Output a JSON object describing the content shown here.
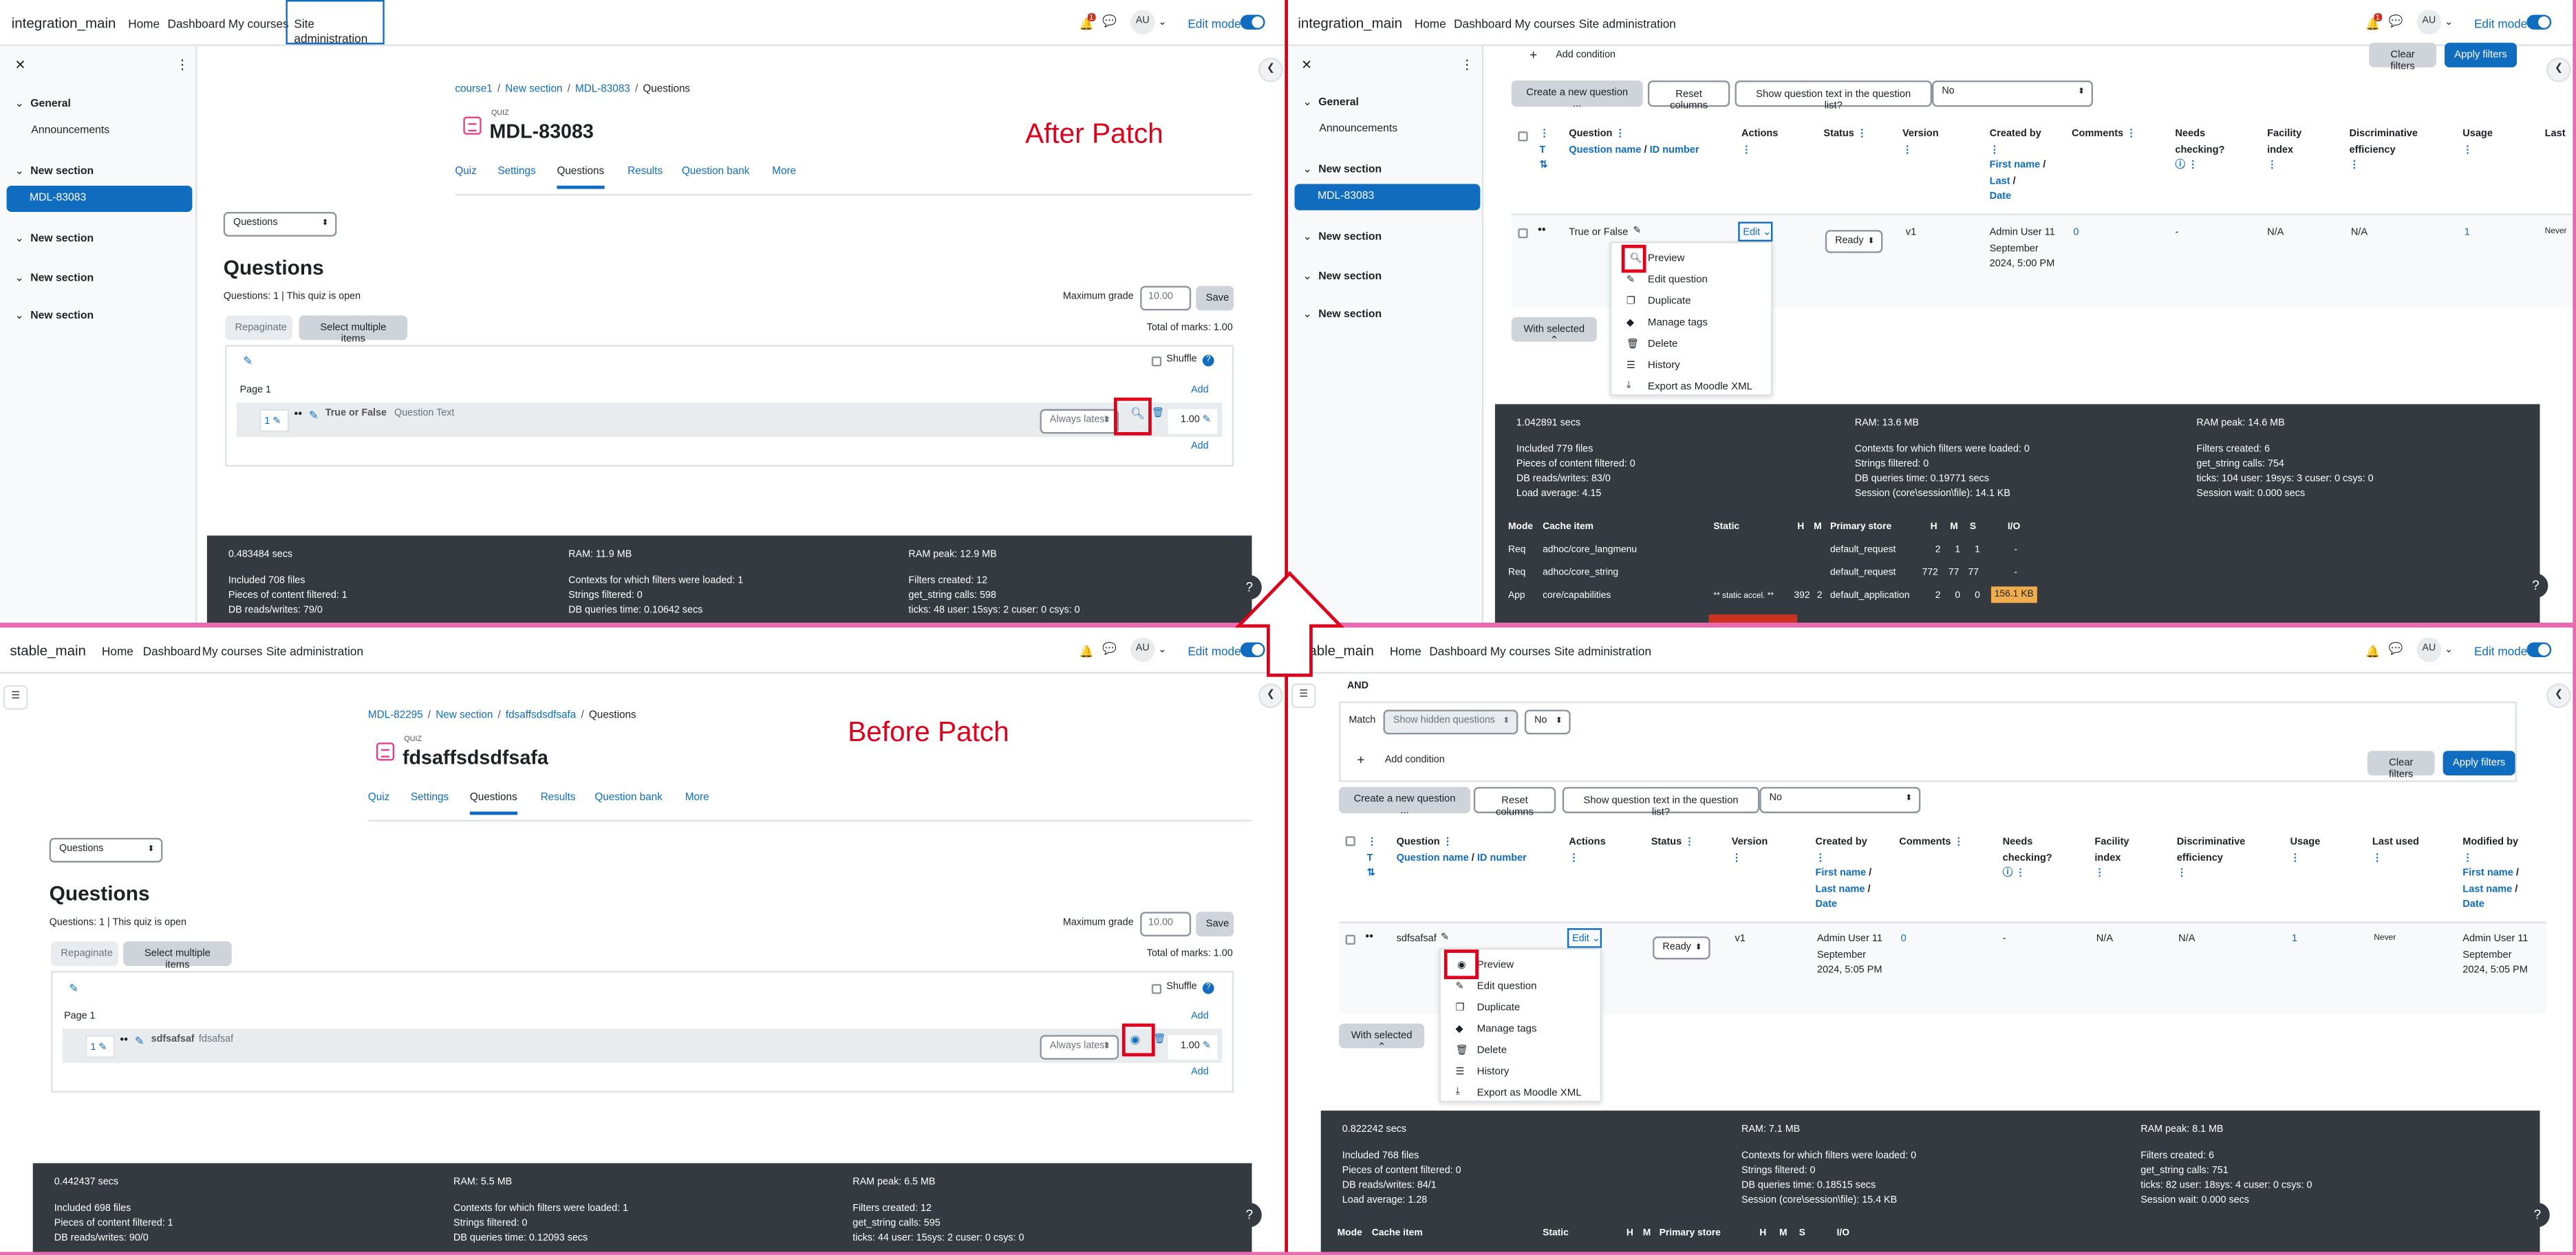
{
  "q1": {
    "brand": "integration_main",
    "nav": [
      "Home",
      "Dashboard",
      "My courses",
      "Site administration"
    ],
    "notif_count": "1",
    "avatar": "AU",
    "edit_mode": "Edit mode",
    "drawer": {
      "general": "General",
      "announcements": "Announcements",
      "new_section": "New section",
      "active": "MDL-83083"
    },
    "breadcrumb": [
      "course1",
      "New section",
      "MDL-83083",
      "Questions"
    ],
    "quiz_label": "QUIZ",
    "title": "MDL-83083",
    "tabs": [
      "Quiz",
      "Settings",
      "Questions",
      "Results",
      "Question bank",
      "More"
    ],
    "select_value": "Questions",
    "heading": "Questions",
    "status_line": "Questions: 1 | This quiz is open",
    "max_grade_label": "Maximum grade",
    "max_grade_value": "10.00",
    "save": "Save",
    "repaginate": "Repaginate",
    "select_multiple": "Select multiple items",
    "total_marks": "Total of marks: 1.00",
    "shuffle": "Shuffle",
    "page": "Page 1",
    "add": "Add",
    "slot_num": "1",
    "q_name": "True or False",
    "q_text": "Question Text",
    "version": "Always latest",
    "mark": "1.00",
    "annotation": "After Patch",
    "perf": {
      "secs": "0.483484 secs",
      "ram": "RAM: 11.9 MB",
      "ram_peak": "RAM peak: 12.9 MB",
      "files": "Included 708 files",
      "filtered": "Pieces of content filtered: 1",
      "dbrw": "DB reads/writes: 79/0",
      "contexts": "Contexts for which filters were loaded: 1",
      "strings": "Strings filtered: 0",
      "dbq": "DB queries time: 0.10642 secs",
      "fcreated": "Filters created: 12",
      "getstr": "get_string calls: 598",
      "ticks": "ticks: 48 user: 15sys: 2 cuser: 0 csys: 0"
    }
  },
  "q2": {
    "brand": "integration_main",
    "nav": [
      "Home",
      "Dashboard",
      "My courses",
      "Site administration"
    ],
    "notif_count": "1",
    "avatar": "AU",
    "edit_mode": "Edit mode",
    "drawer": {
      "general": "General",
      "announcements": "Announcements",
      "new_section": "New section",
      "active": "MDL-83083"
    },
    "add_condition": "Add condition",
    "clear_filters": "Clear filters",
    "apply_filters": "Apply filters",
    "create_new": "Create a new question ...",
    "reset_columns": "Reset columns",
    "show_text_label": "Show question text in the question list?",
    "show_text_value": "No",
    "cols": {
      "t": "T",
      "question": "Question",
      "qname": "Question name",
      "idnum": "ID number",
      "actions": "Actions",
      "status": "Status",
      "version": "Version",
      "created_by": "Created by",
      "first": "First name",
      "last": "Last",
      "date": "Date",
      "comments": "Comments",
      "needs": "Needs checking?",
      "facility": "Facility index",
      "discrim": "Discriminative efficiency",
      "usage": "Usage"
    },
    "row": {
      "name": "True or False",
      "edit": "Edit",
      "status": "Ready",
      "version": "v1",
      "created": "Admin User 11 September 2024, 5:00 PM",
      "comments": "0",
      "needs": "-",
      "facility": "N/A",
      "discrim": "N/A",
      "usage": "1",
      "last": "Never"
    },
    "menu": [
      "Preview",
      "Edit question",
      "Duplicate",
      "Manage tags",
      "Delete",
      "History",
      "Export as Moodle XML"
    ],
    "with_selected": "With selected",
    "perf": {
      "secs": "1.042891 secs",
      "ram": "RAM: 13.6 MB",
      "ram_peak": "RAM peak: 14.6 MB",
      "files": "Included 779 files",
      "filtered": "Pieces of content filtered: 0",
      "dbrw": "DB reads/writes: 83/0",
      "load": "Load average: 4.15",
      "contexts": "Contexts for which filters were loaded: 0",
      "strings": "Strings filtered: 0",
      "dbq": "DB queries time: 0.19771 secs",
      "session": "Session (core\\session\\file): 14.1 KB",
      "fcreated": "Filters created: 6",
      "getstr": "get_string calls: 754",
      "ticks": "ticks: 104 user: 19sys: 3 cuser: 0 csys: 0",
      "wait": "Session wait: 0.000 secs"
    },
    "cache_head": [
      "Mode",
      "Cache item",
      "Static",
      "H",
      "M",
      "Primary store",
      "H",
      "M",
      "S",
      "I/O"
    ],
    "cache_rows": [
      [
        "Req",
        "adhoc/core_langmenu",
        "",
        "",
        "",
        "default_request",
        "2",
        "1",
        "1",
        "-"
      ],
      [
        "Req",
        "adhoc/core_string",
        "",
        "",
        "",
        "default_request",
        "772",
        "77",
        "77",
        "-"
      ],
      [
        "App",
        "core/capabilities",
        "** static accel. **",
        "392",
        "2",
        "default_application",
        "2",
        "0",
        "0",
        "156.1 KB"
      ]
    ]
  },
  "q3": {
    "brand": "stable_main",
    "nav": [
      "Home",
      "Dashboard",
      "My courses",
      "Site administration"
    ],
    "avatar": "AU",
    "edit_mode": "Edit mode",
    "breadcrumb": [
      "MDL-82295",
      "New section",
      "fdsaffsdsdfsafa",
      "Questions"
    ],
    "quiz_label": "QUIZ",
    "title": "fdsaffsdsdfsafa",
    "tabs": [
      "Quiz",
      "Settings",
      "Questions",
      "Results",
      "Question bank",
      "More"
    ],
    "select_value": "Questions",
    "heading": "Questions",
    "status_line": "Questions: 1 | This quiz is open",
    "max_grade_label": "Maximum grade",
    "max_grade_value": "10.00",
    "save": "Save",
    "repaginate": "Repaginate",
    "select_multiple": "Select multiple items",
    "total_marks": "Total of marks: 1.00",
    "shuffle": "Shuffle",
    "page": "Page 1",
    "add": "Add",
    "slot_num": "1",
    "q_name": "sdfsafsaf",
    "q_text": "fdsafsaf",
    "version": "Always latest",
    "mark": "1.00",
    "annotation": "Before Patch",
    "perf": {
      "secs": "0.442437 secs",
      "ram": "RAM: 5.5 MB",
      "ram_peak": "RAM peak: 6.5 MB",
      "files": "Included 698 files",
      "filtered": "Pieces of content filtered: 1",
      "dbrw": "DB reads/writes: 90/0",
      "contexts": "Contexts for which filters were loaded: 1",
      "strings": "Strings filtered: 0",
      "dbq": "DB queries time: 0.12093 secs",
      "fcreated": "Filters created: 12",
      "getstr": "get_string calls: 595",
      "ticks": "ticks: 44 user: 15sys: 2 cuser: 0 csys: 0"
    }
  },
  "q4": {
    "brand": "stable_main",
    "nav": [
      "Home",
      "Dashboard",
      "My courses",
      "Site administration"
    ],
    "avatar": "AU",
    "edit_mode": "Edit mode",
    "and": "AND",
    "match": "Match",
    "match_value": "Show hidden questions",
    "no": "No",
    "add_condition": "Add condition",
    "clear_filters": "Clear filters",
    "apply_filters": "Apply filters",
    "create_new": "Create a new question ...",
    "reset_columns": "Reset columns",
    "show_text_label": "Show question text in the question list?",
    "show_text_value": "No",
    "cols": {
      "t": "T",
      "question": "Question",
      "qname": "Question name",
      "idnum": "ID number",
      "actions": "Actions",
      "status": "Status",
      "version": "Version",
      "created_by": "Created by",
      "first": "First name",
      "last": "Last name",
      "date": "Date",
      "comments": "Comments",
      "needs": "Needs checking?",
      "facility": "Facility index",
      "discrim": "Discriminative efficiency",
      "usage": "Usage",
      "lastused": "Last used",
      "modified": "Modified by"
    },
    "row": {
      "name": "sdfsafsaf",
      "edit": "Edit",
      "status": "Ready",
      "version": "v1",
      "created": "Admin User 11 September 2024, 5:05 PM",
      "comments": "0",
      "needs": "-",
      "facility": "N/A",
      "discrim": "N/A",
      "usage": "1",
      "last": "Never",
      "modified": "Admin User 11 September 2024, 5:05 PM"
    },
    "menu": [
      "Preview",
      "Edit question",
      "Duplicate",
      "Manage tags",
      "Delete",
      "History",
      "Export as Moodle XML"
    ],
    "with_selected": "With selected",
    "perf": {
      "secs": "0.822242 secs",
      "ram": "RAM: 7.1 MB",
      "ram_peak": "RAM peak: 8.1 MB",
      "files": "Included 768 files",
      "filtered": "Pieces of content filtered: 0",
      "dbrw": "DB reads/writes: 84/1",
      "load": "Load average: 1.28",
      "contexts": "Contexts for which filters were loaded: 0",
      "strings": "Strings filtered: 0",
      "dbq": "DB queries time: 0.18515 secs",
      "session": "Session (core\\session\\file): 15.4 KB",
      "fcreated": "Filters created: 6",
      "getstr": "get_string calls: 751",
      "ticks": "ticks: 82 user: 18sys: 4 cuser: 0 csys: 0",
      "wait": "Session wait: 0.000 secs"
    },
    "cache_head": [
      "Mode",
      "Cache item",
      "Static",
      "H",
      "M",
      "Primary store",
      "H",
      "M",
      "S",
      "I/O"
    ]
  },
  "colors": {
    "accent": "#0f6cbf",
    "annotation": "#e0001b",
    "footer": "#343a40",
    "quiz_icon": "#e83e8c",
    "quadrant_border": "#e86ab0"
  },
  "icons": [
    "bell-icon",
    "chat-icon",
    "close-icon",
    "kebab-icon",
    "pencil-icon",
    "move-icon",
    "magnifier-icon",
    "eye-icon",
    "trash-icon",
    "help-icon",
    "chevron-left-icon",
    "up-arrow-icon"
  ]
}
